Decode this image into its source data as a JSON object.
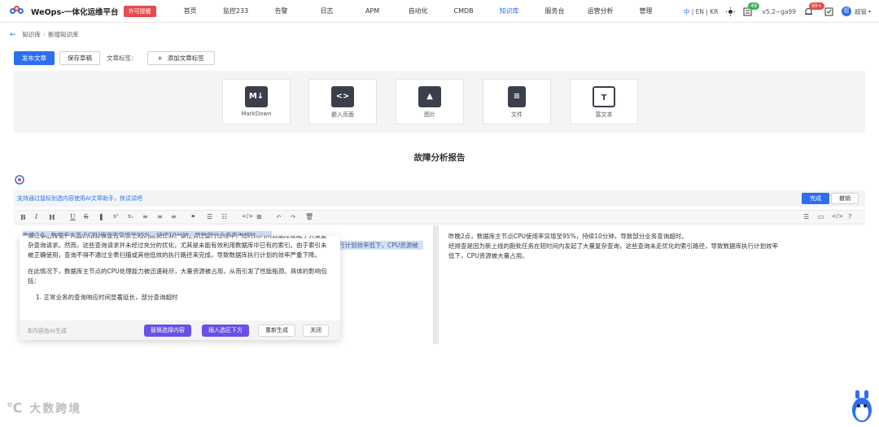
{
  "app": {
    "title": "WeOps-一体化运维平台",
    "license": "许可提醒"
  },
  "menu": [
    "首页",
    "监控233",
    "告警",
    "日志",
    "APM",
    "自动化",
    "CMDB",
    "知识库",
    "服务台",
    "运营分析",
    "管理"
  ],
  "menu_active": "知识库",
  "header_right": {
    "lang_zh": "中",
    "lang_en": "EN",
    "lang_kr": "KR",
    "badge1": "49",
    "version": "v5.2~ga99",
    "badge2": "99+",
    "user": "超管",
    "avatar": "超"
  },
  "breadcrumb": {
    "parent": "知识库",
    "current": "新增知识库"
  },
  "actions": {
    "publish": "发布文章",
    "save_draft": "保存草稿",
    "tags_label": "文章标签：",
    "add_tag": "添加文章标签"
  },
  "insert_cards": [
    {
      "label": "MarkDown",
      "icon": "markdown-icon"
    },
    {
      "label": "嵌入页面",
      "icon": "embed-icon"
    },
    {
      "label": "图片",
      "icon": "image-icon"
    },
    {
      "label": "文件",
      "icon": "file-icon"
    },
    {
      "label": "富文本",
      "icon": "richtext-icon"
    }
  ],
  "doc_title": "故障分析报告",
  "ai_bar": {
    "tip": "支持通过鼠标划选内容使用AI文章助手，快试试吧",
    "done": "完成",
    "undo": "撤销"
  },
  "editor": {
    "selected_text_1": "昨晚2点，数据库主节点CPU使用率突增至95%，持续10分钟，导致部分业务查询超时。",
    "selected_text_2": "行计划效率低下，CPU资源被"
  },
  "ai_popup": {
    "p1": "通过事后排查，问题的根源被定位到新上线的跑批任务。该任务在运行过程中，短时间内向数据库发起了大量复杂查询请求。然而，这些查询请求并未经过充分的优化，尤其是未能有效利用数据库中已有的索引。由于索引未被正确使用，查询不得不通过全表扫描或其他低效的执行路径来完成，导致数据库执行计划的效率严重下降。",
    "p2": "在此情况下，数据库主节点的CPU处理能力被迅速耗尽，大量资源被占用，从而引发了性能瓶颈。具体的影响包括：",
    "p3": "1. 正常业务的查询响应时间显著延长，部分查询超时",
    "note": "本内容由AI生成",
    "replace": "替换选择内容",
    "insert_below": "插入选区下方",
    "regenerate": "重新生成",
    "close": "关闭"
  },
  "preview": {
    "line1": "昨晚2点，数据库主节点CPU使用率突增至95%，持续10分钟，导致部分业务查询超时。",
    "line2": "经排查是因为新上线的跑批任务在短时间内发起了大量复杂查询，这些查询未走优化的索引路径，导致数据库执行计划效率",
    "line3": "低下，CPU资源被大量占用。"
  },
  "watermark": "大数跨境",
  "colors": {
    "primary": "#2d6ef0",
    "purple": "#6a4fe8",
    "danger": "#e64c4c"
  }
}
